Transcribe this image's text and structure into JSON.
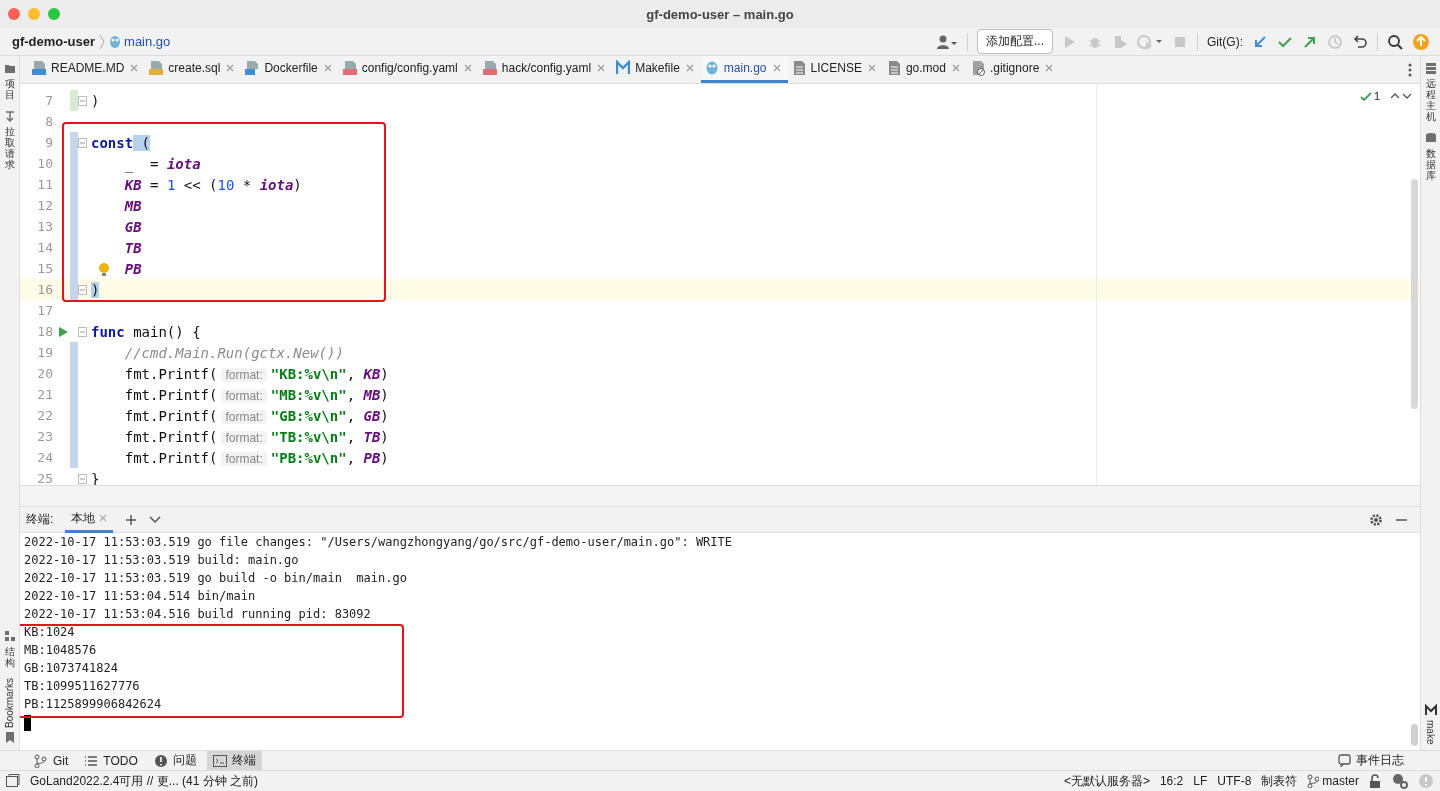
{
  "window": {
    "title": "gf-demo-user – main.go"
  },
  "breadcrumb": [
    {
      "label": "gf-demo-user",
      "kind": "project"
    },
    {
      "label": "main.go",
      "kind": "go"
    }
  ],
  "toolbar": {
    "config_button": "添加配置...",
    "git_label": "Git(G):"
  },
  "left_tool_strip": [
    {
      "label": "项目",
      "kind": "folder"
    },
    {
      "label": "拉取请求",
      "kind": "pull"
    }
  ],
  "left_tool_strip_bottom": [
    {
      "label": "结构",
      "kind": "structure"
    },
    {
      "label": "Bookmarks",
      "kind": "bookmark"
    }
  ],
  "right_tool_strip": [
    {
      "label": "远程主机",
      "kind": "server"
    },
    {
      "label": "数据库",
      "kind": "database"
    },
    {
      "label": "make",
      "kind": "make"
    }
  ],
  "tabs": [
    {
      "label": "README.MD",
      "kind": "md",
      "selected": false
    },
    {
      "label": "create.sql",
      "kind": "sql",
      "selected": false
    },
    {
      "label": "Dockerfile",
      "kind": "docker",
      "selected": false
    },
    {
      "label": "config/config.yaml",
      "kind": "yml",
      "selected": false
    },
    {
      "label": "hack/config.yaml",
      "kind": "yml",
      "selected": false
    },
    {
      "label": "Makefile",
      "kind": "make",
      "selected": false
    },
    {
      "label": "main.go",
      "kind": "go",
      "selected": true
    },
    {
      "label": "LICENSE",
      "kind": "text",
      "selected": false
    },
    {
      "label": "go.mod",
      "kind": "text",
      "selected": false
    },
    {
      "label": ".gitignore",
      "kind": "ignore",
      "selected": false
    }
  ],
  "editor": {
    "inspection_count": "1",
    "blocks": [
      {
        "boxed": false,
        "lines": [
          {
            "number": "7",
            "color": "#d8ead2",
            "fold": true,
            "current": false,
            "run": false,
            "bulb": false,
            "tokens": [
              {
                "kind": "plain",
                "text": ")"
              }
            ]
          },
          {
            "number": "8",
            "fold": false,
            "current": false,
            "run": false,
            "bulb": false
          }
        ]
      },
      {
        "boxed": true,
        "lines": [
          {
            "number": "9",
            "color": "#c4d6ec",
            "fold": true,
            "current": false,
            "run": false,
            "bulb": false,
            "tokens": [
              {
                "kind": "keyword",
                "text": "const"
              },
              {
                "kind": "match",
                "text": " ("
              }
            ]
          },
          {
            "number": "10",
            "color": "#c4d6ec",
            "fold": false,
            "current": false,
            "run": false,
            "bulb": false,
            "tokens": [
              {
                "kind": "plain",
                "text": "    _  = "
              },
              {
                "kind": "constant",
                "text": "iota"
              }
            ]
          },
          {
            "number": "11",
            "color": "#c4d6ec",
            "fold": false,
            "current": false,
            "run": false,
            "bulb": false,
            "tokens": [
              {
                "kind": "constant",
                "text": "    KB"
              },
              {
                "kind": "plain",
                "text": " = "
              },
              {
                "kind": "number",
                "text": "1"
              },
              {
                "kind": "plain",
                "text": " << ("
              },
              {
                "kind": "number",
                "text": "10"
              },
              {
                "kind": "plain",
                "text": " * "
              },
              {
                "kind": "constant",
                "text": "iota"
              },
              {
                "kind": "plain",
                "text": ")"
              }
            ]
          },
          {
            "number": "12",
            "color": "#c4d6ec",
            "fold": false,
            "current": false,
            "run": false,
            "bulb": false,
            "tokens": [
              {
                "kind": "constant",
                "text": "    MB"
              }
            ]
          },
          {
            "number": "13",
            "color": "#c4d6ec",
            "fold": false,
            "current": false,
            "run": false,
            "bulb": false,
            "tokens": [
              {
                "kind": "constant",
                "text": "    GB"
              }
            ]
          },
          {
            "number": "14",
            "color": "#c4d6ec",
            "fold": false,
            "current": false,
            "run": false,
            "bulb": false,
            "tokens": [
              {
                "kind": "constant",
                "text": "    TB"
              }
            ]
          },
          {
            "number": "15",
            "color": "#c4d6ec",
            "fold": false,
            "current": false,
            "run": false,
            "bulb": true,
            "tokens": [
              {
                "kind": "constant",
                "text": "    PB"
              }
            ]
          },
          {
            "number": "16",
            "color": "#c4d6ec",
            "fold": true,
            "current": true,
            "run": false,
            "bulb": false,
            "tokens": [
              {
                "kind": "match",
                "text": ")"
              }
            ]
          }
        ]
      },
      {
        "boxed": false,
        "lines": [
          {
            "number": "17",
            "fold": false,
            "current": false,
            "run": false,
            "bulb": false
          },
          {
            "number": "18",
            "fold": true,
            "current": false,
            "run": true,
            "bulb": false,
            "tokens": [
              {
                "kind": "keyword",
                "text": "func"
              },
              {
                "kind": "plain",
                "text": " main() {"
              }
            ]
          },
          {
            "number": "19",
            "color": "#c4d6ec",
            "fold": false,
            "current": false,
            "run": false,
            "bulb": false,
            "tokens": [
              {
                "kind": "comment",
                "text": "    //cmd.Main.Run(gctx.New())"
              }
            ]
          },
          {
            "number": "20",
            "color": "#c4d6ec",
            "fold": false,
            "current": false,
            "run": false,
            "bulb": false,
            "tokens": [
              {
                "kind": "plain",
                "text": "    fmt.Printf("
              },
              {
                "kind": "hint",
                "text": "format:"
              },
              {
                "kind": "string",
                "text": "\"KB:%v\\n\""
              },
              {
                "kind": "plain",
                "text": ", "
              },
              {
                "kind": "constant",
                "text": "KB"
              },
              {
                "kind": "plain",
                "text": ")"
              }
            ]
          },
          {
            "number": "21",
            "color": "#c4d6ec",
            "fold": false,
            "current": false,
            "run": false,
            "bulb": false,
            "tokens": [
              {
                "kind": "plain",
                "text": "    fmt.Printf("
              },
              {
                "kind": "hint",
                "text": "format:"
              },
              {
                "kind": "string",
                "text": "\"MB:%v\\n\""
              },
              {
                "kind": "plain",
                "text": ", "
              },
              {
                "kind": "constant",
                "text": "MB"
              },
              {
                "kind": "plain",
                "text": ")"
              }
            ]
          },
          {
            "number": "22",
            "color": "#c4d6ec",
            "fold": false,
            "current": false,
            "run": false,
            "bulb": false,
            "tokens": [
              {
                "kind": "plain",
                "text": "    fmt.Printf("
              },
              {
                "kind": "hint",
                "text": "format:"
              },
              {
                "kind": "string",
                "text": "\"GB:%v\\n\""
              },
              {
                "kind": "plain",
                "text": ", "
              },
              {
                "kind": "constant",
                "text": "GB"
              },
              {
                "kind": "plain",
                "text": ")"
              }
            ]
          },
          {
            "number": "23",
            "color": "#c4d6ec",
            "fold": false,
            "current": false,
            "run": false,
            "bulb": false,
            "tokens": [
              {
                "kind": "plain",
                "text": "    fmt.Printf("
              },
              {
                "kind": "hint",
                "text": "format:"
              },
              {
                "kind": "string",
                "text": "\"TB:%v\\n\""
              },
              {
                "kind": "plain",
                "text": ", "
              },
              {
                "kind": "constant",
                "text": "TB"
              },
              {
                "kind": "plain",
                "text": ")"
              }
            ]
          },
          {
            "number": "24",
            "color": "#c4d6ec",
            "fold": false,
            "current": false,
            "run": false,
            "bulb": false,
            "tokens": [
              {
                "kind": "plain",
                "text": "    fmt.Printf("
              },
              {
                "kind": "hint",
                "text": "format:"
              },
              {
                "kind": "string",
                "text": "\"PB:%v\\n\""
              },
              {
                "kind": "plain",
                "text": ", "
              },
              {
                "kind": "constant",
                "text": "PB"
              },
              {
                "kind": "plain",
                "text": ")"
              }
            ]
          },
          {
            "number": "25",
            "fold": true,
            "current": false,
            "run": false,
            "bulb": false,
            "tokens": [
              {
                "kind": "plain",
                "text": "}"
              }
            ]
          }
        ]
      }
    ]
  },
  "terminal": {
    "title": "终端:",
    "tabs": [
      {
        "label": "本地",
        "selected": true
      }
    ],
    "blocks": [
      {
        "boxed": false,
        "lines": [
          "2022-10-17 11:53:03.519 go file changes: \"/Users/wangzhongyang/go/src/gf-demo-user/main.go\": WRITE",
          "2022-10-17 11:53:03.519 build: main.go",
          "2022-10-17 11:53:03.519 go build -o bin/main  main.go",
          "2022-10-17 11:53:04.514 bin/main",
          "2022-10-17 11:53:04.516 build running pid: 83092"
        ]
      },
      {
        "boxed": true,
        "lines": [
          "KB:1024",
          "MB:1048576",
          "GB:1073741824",
          "TB:1099511627776",
          "PB:1125899906842624"
        ]
      }
    ]
  },
  "bottom_tools": [
    {
      "label": "Git",
      "kind": "branch",
      "selected": false
    },
    {
      "label": "TODO",
      "kind": "list",
      "selected": false
    },
    {
      "label": "问题",
      "kind": "alert",
      "selected": false
    },
    {
      "label": "终端",
      "kind": "terminal",
      "selected": true
    }
  ],
  "event_log": "事件日志",
  "status_bar": {
    "message": "GoLand2022.2.4可用 // 更... (41 分钟 之前)",
    "items": [
      {
        "text": "<无默认服务器>",
        "kind": "text"
      },
      {
        "text": "16:2",
        "kind": "text"
      },
      {
        "text": "LF",
        "kind": "text"
      },
      {
        "text": "UTF-8",
        "kind": "text"
      },
      {
        "text": "制表符",
        "kind": "text"
      },
      {
        "text": "master",
        "kind": "branch"
      }
    ]
  }
}
